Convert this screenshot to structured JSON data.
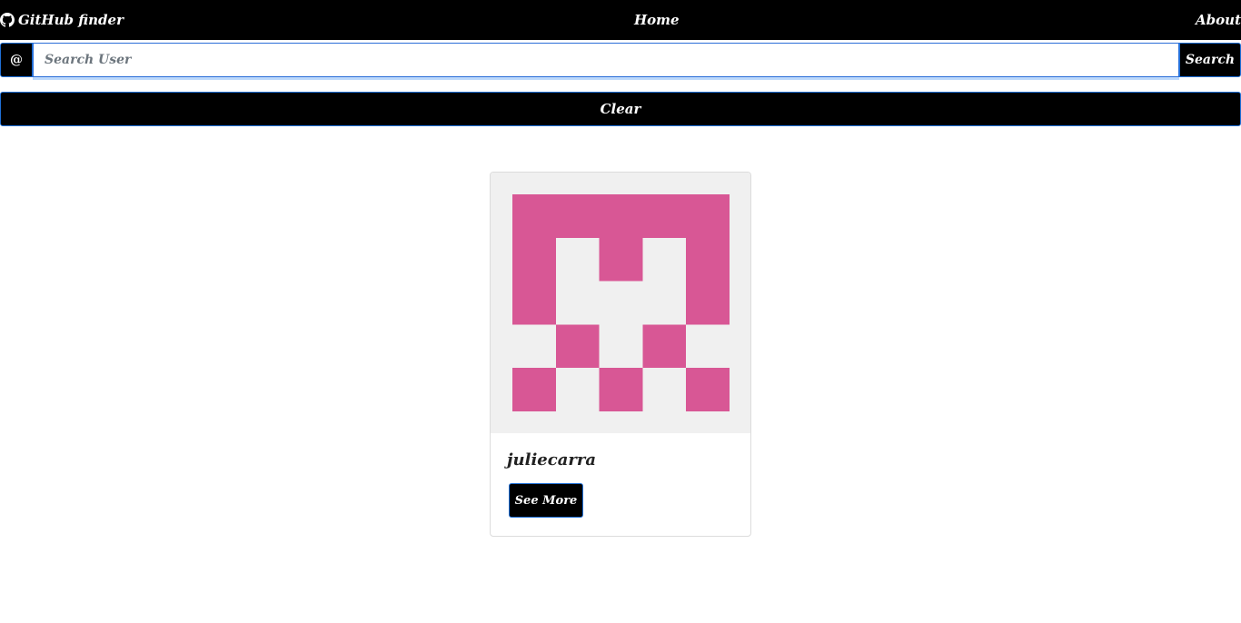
{
  "navbar": {
    "brand_label": "GitHub finder",
    "brand_icon": "github-icon",
    "home_label": "Home",
    "about_label": "About"
  },
  "search": {
    "addon_label": "@",
    "placeholder": "Search User",
    "value": "",
    "button_label": "Search"
  },
  "clear_button_label": "Clear",
  "results": [
    {
      "username": "juliecarra",
      "see_more_label": "See More",
      "avatar_color": "#d85795",
      "avatar_background": "#f0f0f0"
    }
  ],
  "colors": {
    "navbar": "#000000",
    "button": "#000000",
    "button_border": "#1f6fd6"
  }
}
